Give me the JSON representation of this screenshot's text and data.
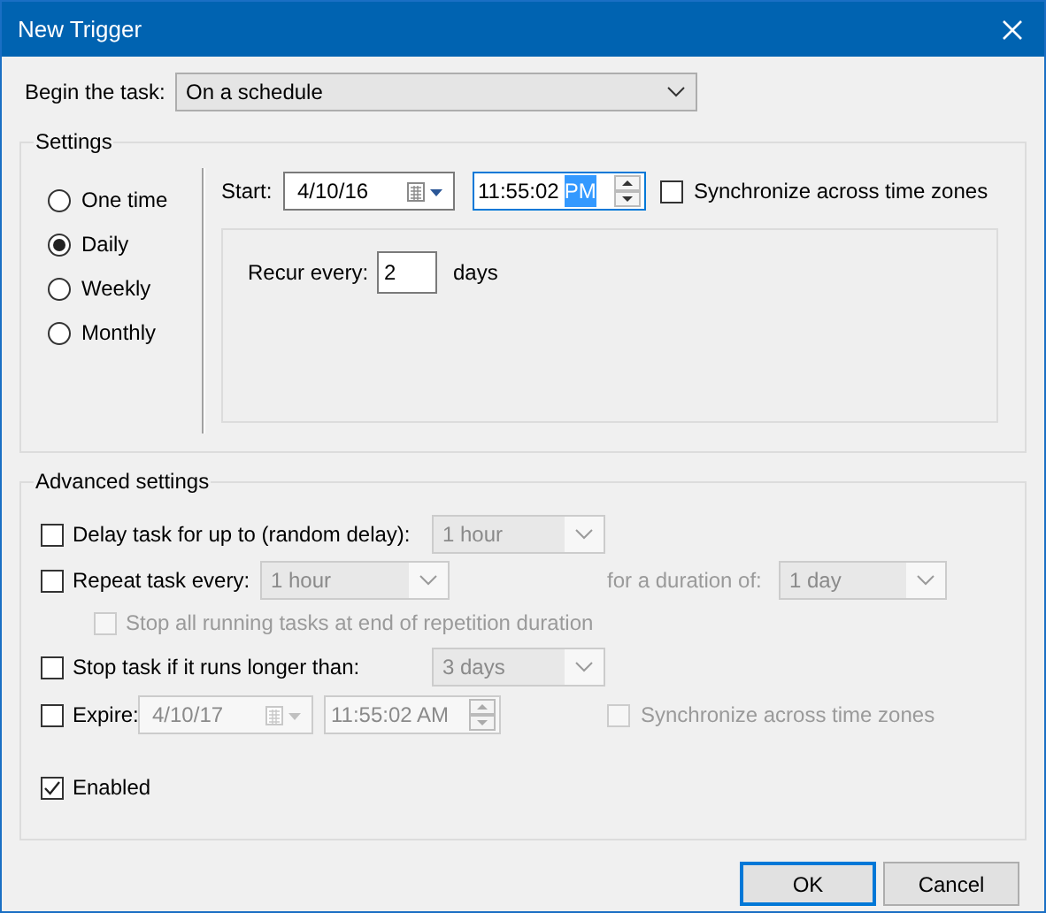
{
  "window": {
    "title": "New Trigger"
  },
  "begin_task": {
    "label": "Begin the task:",
    "value": "On a schedule"
  },
  "settings": {
    "title": "Settings",
    "schedule_options": [
      {
        "label": "One time",
        "selected": false
      },
      {
        "label": "Daily",
        "selected": true
      },
      {
        "label": "Weekly",
        "selected": false
      },
      {
        "label": "Monthly",
        "selected": false
      }
    ],
    "start": {
      "label": "Start:",
      "date": "4/10/16",
      "time_parts": [
        {
          "text": "11:55:02",
          "selected": false
        },
        {
          "text": "PM",
          "selected": true
        }
      ],
      "sync": {
        "label": "Synchronize across time zones",
        "checked": false,
        "disabled": false
      }
    },
    "recur": {
      "label": "Recur every:",
      "value": "2",
      "unit": "days"
    }
  },
  "advanced": {
    "title": "Advanced settings",
    "delay": {
      "label": "Delay task for up to (random delay):",
      "checked": false,
      "combo": {
        "value": "1 hour",
        "disabled": true
      }
    },
    "repeat": {
      "label": "Repeat task every:",
      "checked": false,
      "combo": {
        "value": "1 hour",
        "disabled": true
      },
      "duration_label": "for a duration of:",
      "duration_combo": {
        "value": "1 day",
        "disabled": true
      }
    },
    "stop_all": {
      "label": "Stop all running tasks at end of repetition duration",
      "checked": false,
      "disabled": true
    },
    "stop_task": {
      "label": "Stop task if it runs longer than:",
      "checked": false,
      "combo": {
        "value": "3 days",
        "disabled": true
      }
    },
    "expire": {
      "label": "Expire:",
      "checked": false,
      "date": "4/10/17",
      "time": "11:55:02 AM",
      "sync": {
        "label": "Synchronize across time zones",
        "checked": false,
        "disabled": true
      }
    },
    "enabled": {
      "label": "Enabled",
      "checked": true
    }
  },
  "buttons": [
    {
      "label": "OK",
      "default": true
    },
    {
      "label": "Cancel",
      "default": false
    }
  ]
}
